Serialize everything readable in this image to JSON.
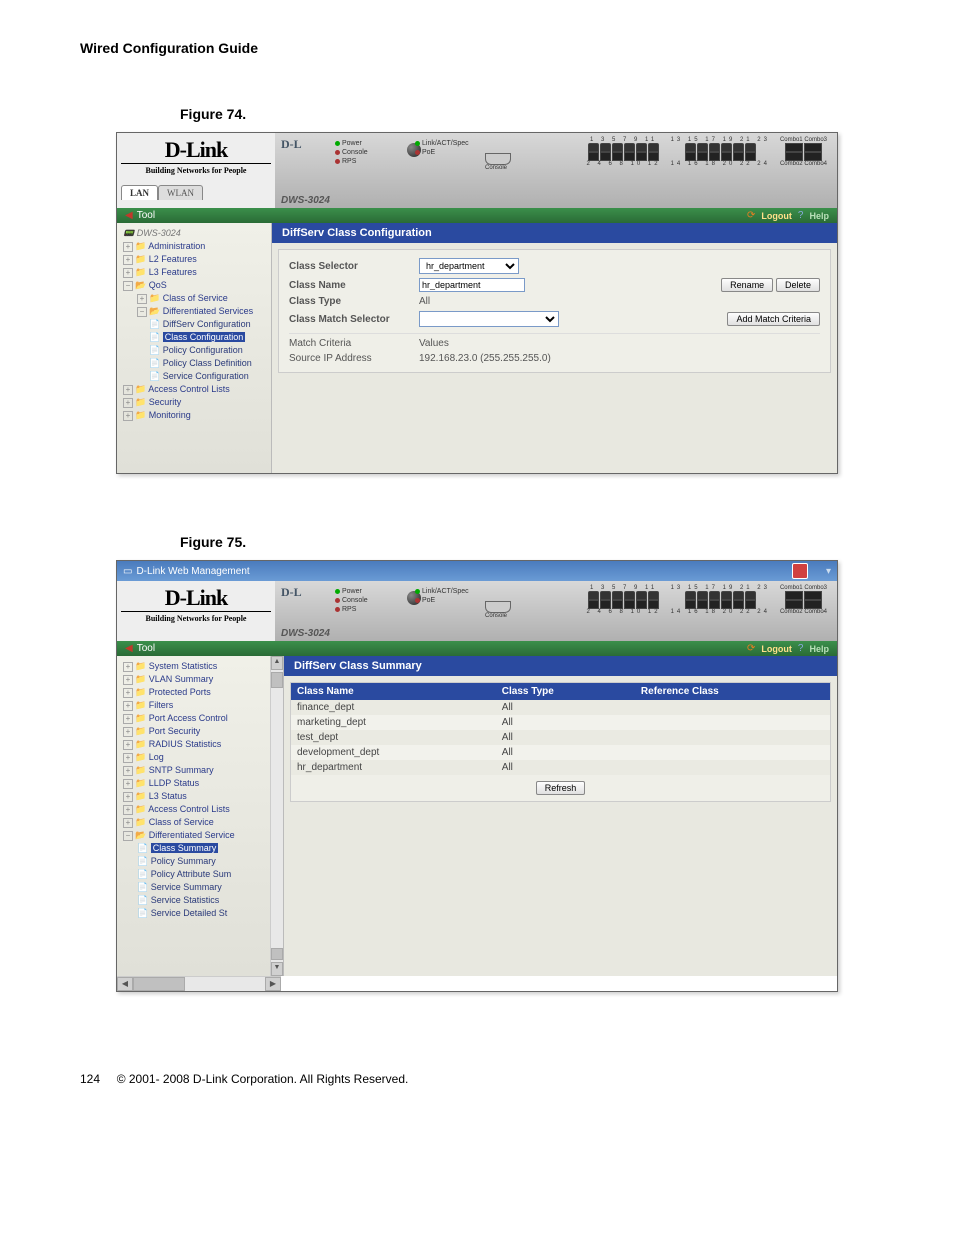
{
  "doc": {
    "header": "Wired Configuration Guide",
    "footer_page": "124",
    "footer_copy": "© 2001- 2008 D-Link Corporation. All Rights Reserved."
  },
  "fig74": {
    "caption": "Figure 74.",
    "brand": "D-Link",
    "tagline": "Building Networks for People",
    "model": "DWS-3024",
    "leds_col1": [
      "Power",
      "Console",
      "RPS"
    ],
    "leds_col2": [
      "Link/ACT/Spec",
      "PoE"
    ],
    "console_label": "Console",
    "port_nums_top": "1 3 5 7 9 11",
    "port_nums_bot": "2 4 6 8 10 12",
    "port_nums_top2": "13 15 17 19 21 23",
    "port_nums_bot2": "14 16 18 20 22 24",
    "combo1": "Combo1 Combo3",
    "combo2": "Combo2 Combo4",
    "tool_label": "Tool",
    "logout": "Logout",
    "help": "Help",
    "tab_lan": "LAN",
    "tab_wlan": "WLAN",
    "tree": {
      "device": "DWS-3024",
      "administration": "Administration",
      "l2": "L2 Features",
      "l3": "L3 Features",
      "qos": "QoS",
      "cos": "Class of Service",
      "ds": "Differentiated Services",
      "dsconf": "DiffServ Configuration",
      "classconf": "Class Configuration",
      "polconf": "Policy Configuration",
      "polclass": "Policy Class Definition",
      "svcconf": "Service Configuration",
      "acl": "Access Control Lists",
      "security": "Security",
      "monitoring": "Monitoring"
    },
    "panel_title": "DiffServ Class Configuration",
    "form": {
      "class_selector_lbl": "Class Selector",
      "class_selector_val": "hr_department",
      "class_name_lbl": "Class Name",
      "class_name_val": "hr_department",
      "class_type_lbl": "Class Type",
      "class_type_val": "All",
      "match_selector_lbl": "Class Match Selector",
      "rename_btn": "Rename",
      "delete_btn": "Delete",
      "add_match_btn": "Add Match Criteria",
      "match_criteria_lbl": "Match Criteria",
      "values_lbl": "Values",
      "src_ip_lbl": "Source IP Address",
      "src_ip_val": "192.168.23.0 (255.255.255.0)"
    }
  },
  "fig75": {
    "caption": "Figure 75.",
    "titlebar": "D-Link Web Management",
    "brand": "D-Link",
    "tagline": "Building Networks for People",
    "model": "DWS-3024",
    "tool_label": "Tool",
    "logout": "Logout",
    "help": "Help",
    "tree": {
      "sysstat": "System Statistics",
      "vlan": "VLAN Summary",
      "protports": "Protected Ports",
      "filters": "Filters",
      "pac": "Port Access Control",
      "portsec": "Port Security",
      "radius": "RADIUS Statistics",
      "log": "Log",
      "sntp": "SNTP Summary",
      "lldp": "LLDP Status",
      "l3status": "L3 Status",
      "acl": "Access Control Lists",
      "cos": "Class of Service",
      "ds": "Differentiated Service",
      "classsum": "Class Summary",
      "polsum": "Policy Summary",
      "polattr": "Policy Attribute Sum",
      "svcsum": "Service Summary",
      "svcstat": "Service Statistics",
      "svcdet": "Service Detailed St"
    },
    "panel_title": "DiffServ Class Summary",
    "table": {
      "h1": "Class Name",
      "h2": "Class Type",
      "h3": "Reference Class",
      "rows": [
        {
          "name": "finance_dept",
          "type": "All",
          "ref": ""
        },
        {
          "name": "marketing_dept",
          "type": "All",
          "ref": ""
        },
        {
          "name": "test_dept",
          "type": "All",
          "ref": ""
        },
        {
          "name": "development_dept",
          "type": "All",
          "ref": ""
        },
        {
          "name": "hr_department",
          "type": "All",
          "ref": ""
        }
      ],
      "refresh_btn": "Refresh"
    }
  }
}
